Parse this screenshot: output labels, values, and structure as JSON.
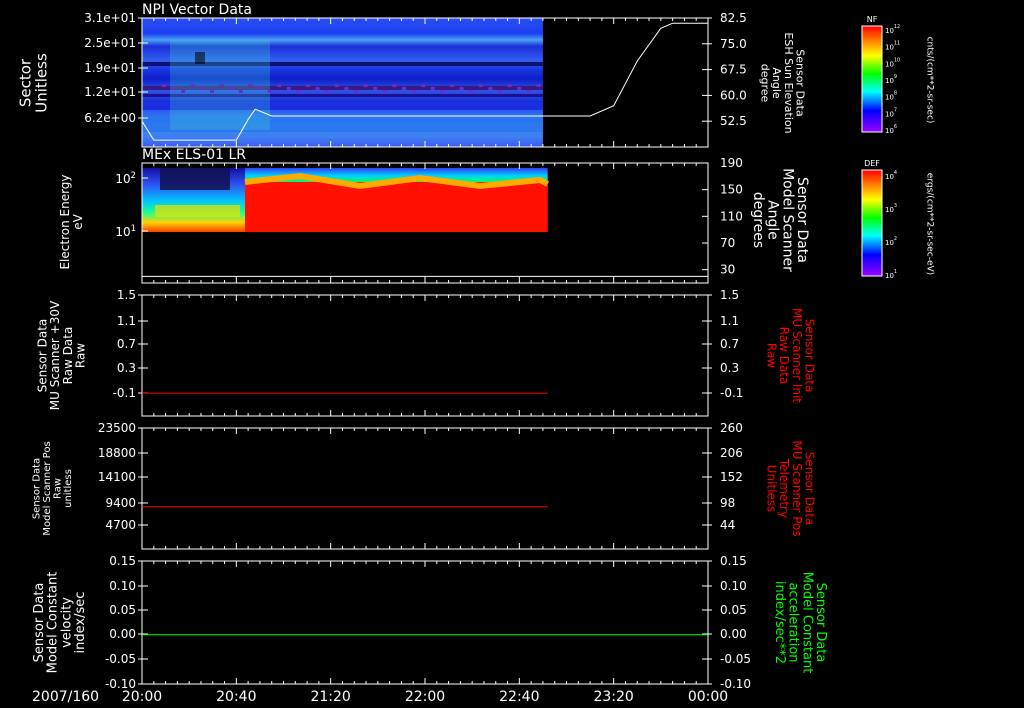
{
  "colors": {
    "background": "#000000",
    "axis": "#ffffff",
    "red": "#ff0000",
    "green": "#00ff00"
  },
  "time_axis": {
    "date_label": "2007/160",
    "tick_labels": [
      "20:00",
      "20:40",
      "21:20",
      "22:00",
      "22:40",
      "23:20",
      "00:00"
    ]
  },
  "chart_data": [
    {
      "type": "heatmap",
      "title": "NPI Vector Data",
      "ylabel_left": [
        "Sector",
        "Unitless"
      ],
      "left_tick_labels": [
        "3.1e+01",
        "2.5e+01",
        "1.9e+01",
        "1.2e+01",
        "6.2e+00"
      ],
      "ylabel_right": [
        "Sensor Data",
        "ESH Sun Elevation",
        "Angle",
        "degree"
      ],
      "right_tick_labels": [
        "82.5",
        "75.0",
        "67.5",
        "60.0",
        "52.5"
      ],
      "ylim_right": [
        45,
        82.5
      ],
      "data_end_time": "22:50",
      "overlay_line": {
        "name": "ESH Sun Elevation Angle",
        "x": [
          "20:00",
          "20:05",
          "20:40",
          "20:45",
          "20:48",
          "20:55",
          "22:50",
          "23:10",
          "23:20",
          "23:30",
          "23:40",
          "23:45",
          "00:00"
        ],
        "y": [
          52.5,
          47,
          47,
          53,
          56,
          54,
          54,
          54,
          57,
          70,
          79.5,
          81,
          81
        ]
      },
      "colorbar": {
        "name": "NF",
        "units": "cnts/(cm**2-sr-sec)",
        "tick_labels": [
          "10^12",
          "10^11",
          "10^10",
          "10^9",
          "10^8",
          "10^7",
          "10^6"
        ]
      }
    },
    {
      "type": "heatmap",
      "title": "MEx ELS-01 LR",
      "ylabel_left": [
        "Electron Energy",
        "eV"
      ],
      "left_tick_labels": [
        "10^2",
        "10^1"
      ],
      "ylabel_right": [
        "Sensor Data",
        "Model Scanner",
        "Angle",
        "degrees"
      ],
      "right_tick_labels": [
        "190",
        "150",
        "110",
        "70",
        "30"
      ],
      "ylim_right": [
        10,
        190
      ],
      "data_end_time": "22:52",
      "overlay_line": {
        "name": "Model Scanner Angle",
        "x": [
          "20:00",
          "00:00"
        ],
        "y": [
          20,
          20
        ]
      },
      "colorbar": {
        "name": "DEF",
        "units": "ergs/(cm**2-sr-sec-eV)",
        "tick_labels": [
          "10^4",
          "10^3",
          "10^2",
          "10^1"
        ]
      }
    },
    {
      "type": "line",
      "ylabel_left": [
        "Sensor Data",
        "MU Scanner +30V",
        "Raw Data",
        "Raw"
      ],
      "left_tick_labels": [
        "1.5",
        "1.1",
        "0.7",
        "0.3",
        "-0.1"
      ],
      "ylim": [
        -0.35,
        1.5
      ],
      "ylabel_right": [
        "Sensor Data",
        "MU Scanner Init",
        "Raw Data",
        "Raw"
      ],
      "right_tick_labels": [
        "1.5",
        "1.1",
        "0.7",
        "0.3",
        "-0.1"
      ],
      "series": [
        {
          "color": "#ff0000",
          "x": [
            "20:00",
            "22:52"
          ],
          "y": [
            0,
            0
          ]
        }
      ]
    },
    {
      "type": "line",
      "ylabel_left": [
        "Sensor Data",
        "Model Scanner Pos",
        "Raw",
        "unitless"
      ],
      "left_tick_labels": [
        "23500",
        "18800",
        "14100",
        "9400",
        "4700"
      ],
      "ylim": [
        0,
        23500
      ],
      "ylabel_right": [
        "Sensor Data",
        "MU Scanner Pos",
        "Telemetry",
        "Unitless"
      ],
      "right_tick_labels": [
        "260",
        "206",
        "152",
        "98",
        "44"
      ],
      "series": [
        {
          "color": "#ff0000",
          "x": [
            "20:00",
            "22:52"
          ],
          "y": [
            8200,
            8200
          ]
        }
      ]
    },
    {
      "type": "line",
      "ylabel_left": [
        "Sensor Data",
        "Model Constant",
        "velocity",
        "index/sec"
      ],
      "left_tick_labels": [
        "0.15",
        "0.10",
        "0.05",
        "0.00",
        "-0.05",
        "-0.10"
      ],
      "ylim": [
        -0.1,
        0.15
      ],
      "ylabel_right": [
        "Sensor Data",
        "Model Constant",
        "acceleration",
        "index/sec**2"
      ],
      "right_tick_labels": [
        "0.15",
        "0.10",
        "0.05",
        "0.00",
        "-0.05",
        "-0.10"
      ],
      "series": [
        {
          "color": "#00ff00",
          "x": [
            "20:00",
            "00:00"
          ],
          "y": [
            0,
            0
          ]
        }
      ]
    }
  ]
}
